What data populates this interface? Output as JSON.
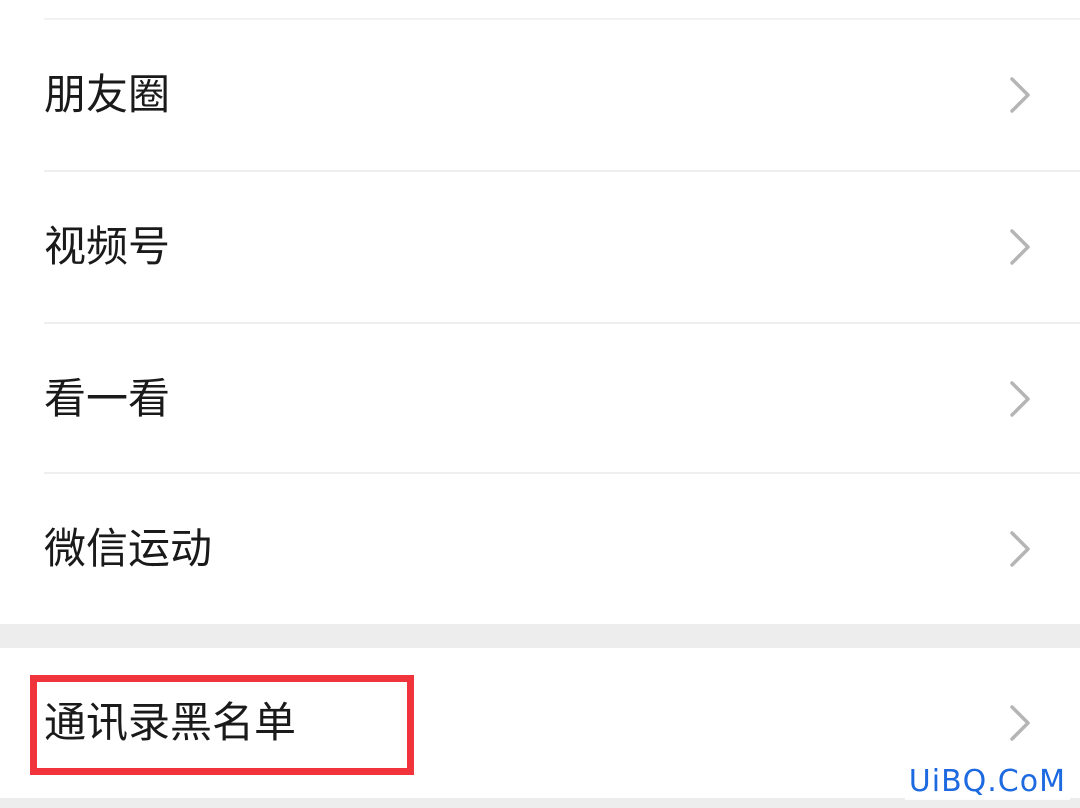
{
  "colors": {
    "page_background": "#ededed",
    "cell_background": "#ffffff",
    "label_text": "#1a1a1a",
    "chevron": "#b5b5b5",
    "highlight_border": "#f1343c",
    "watermark_text": "#1d6ae0"
  },
  "settings": {
    "items": [
      {
        "label": "朋友圈",
        "icon": "chevron-right-icon"
      },
      {
        "label": "视频号",
        "icon": "chevron-right-icon"
      },
      {
        "label": "看一看",
        "icon": "chevron-right-icon"
      },
      {
        "label": "微信运动",
        "icon": "chevron-right-icon"
      }
    ],
    "blacklist": {
      "label": "通讯录黑名单",
      "icon": "chevron-right-icon",
      "highlighted": true
    }
  },
  "watermark": {
    "text": "UiBQ.CoM"
  }
}
